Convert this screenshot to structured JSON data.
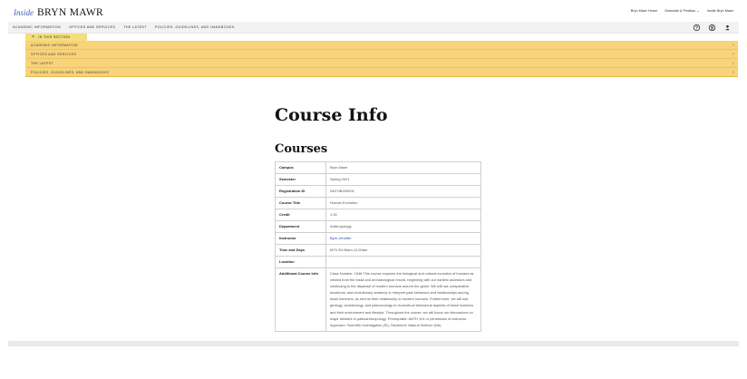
{
  "header": {
    "brand_inside": "Inside",
    "brand_name": "BRYN MAWR",
    "util_links": {
      "home": "Bryn Mawr Home",
      "graduate": "Graduate & Postbac",
      "inside": "Inside Bryn Mawr"
    }
  },
  "nav": {
    "items": [
      "ACADEMIC INFORMATION",
      "OFFICES AND SERVICES",
      "THE LATEST",
      "POLICIES, GUIDELINES, AND HANDBOOKS"
    ],
    "icons": [
      "help-icon",
      "account-icon",
      "user-icon"
    ]
  },
  "section_nav": {
    "toggle_label": "IN THIS SECTION",
    "items": [
      "ACADEMIC INFORMATION",
      "OFFICES AND SERVICES",
      "THE LATEST",
      "POLICIES, GUIDELINES, AND HANDBOOKS"
    ]
  },
  "page": {
    "title": "Course Info",
    "heading": "Courses"
  },
  "course_table": {
    "rows": [
      {
        "label": "Campus",
        "value": "Bryn Mawr"
      },
      {
        "label": "Semester",
        "value": "Spring 2021"
      },
      {
        "label": "Registration ID",
        "value": "ANTHB209001"
      },
      {
        "label": "Course Title",
        "value": "Human Evolution"
      },
      {
        "label": "Credit",
        "value": "1.00"
      },
      {
        "label": "Department",
        "value": "Anthropology"
      },
      {
        "label": "Instructor",
        "value": "Byrn,Jennifer"
      },
      {
        "label": "Time and Days",
        "value": "MTh 09:40am-11:00am"
      },
      {
        "label": "Location",
        "value": ""
      },
      {
        "label": "Additional Course Info",
        "value": "Class Number: 1548 This course explores the biological and cultural evolution of humans as viewed from the fossil and archaeological record, beginning with our earliest ancestors and continuing to the dispersal of modern humans around the globe. We will use comparative, functional, and evolutionary anatomy to interpret past behaviors and relationships among fossil hominins, as well as their relationship to modern humans. Furthermore, we will use geology, archaeology, and paleoecology to reconstruct behavioral aspects of fossil hominins and their environment and lifestyle. Throughout the course, we will focus our discussions on major debates in paleoanthropology. Prerequisite: ANTH 101 or permission of instructor. Approach: Scientific Investigation (SI); Haverford: Natural Science (NA)"
      }
    ]
  },
  "colors": {
    "accent_yellow": "#f8d37a",
    "tab_yellow": "#f6dd7e",
    "link_blue": "#2a4d9a",
    "brand_blue": "#3a5fb0"
  }
}
